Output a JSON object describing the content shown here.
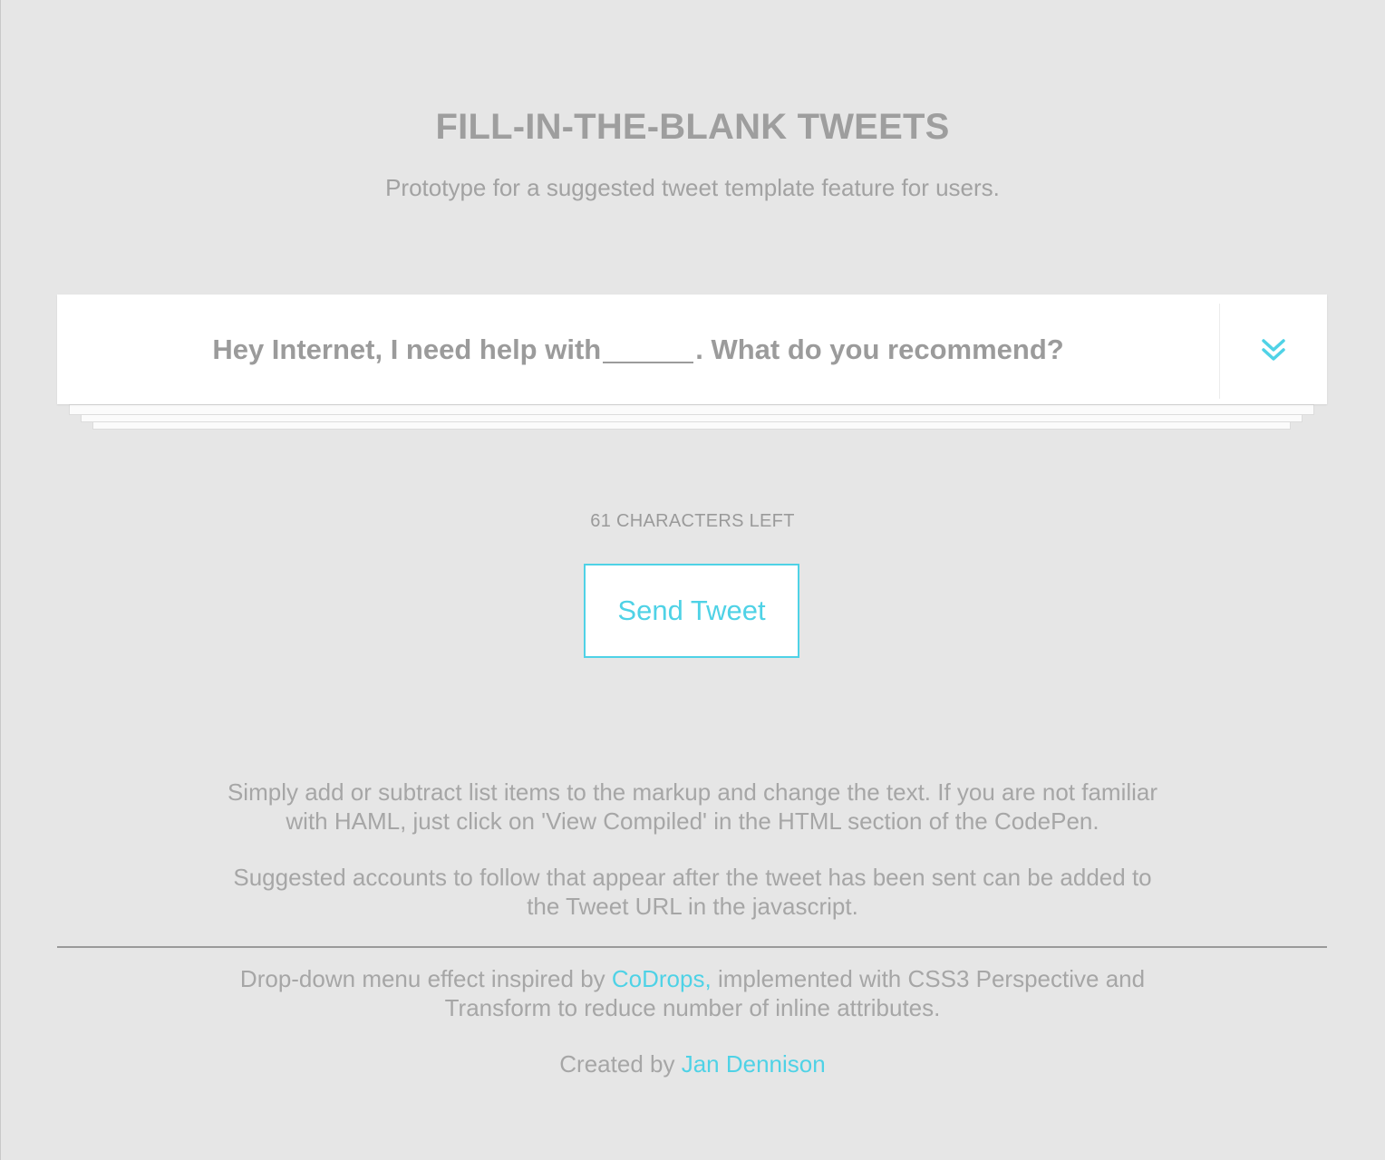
{
  "header": {
    "title": "FILL-IN-THE-BLANK TWEETS",
    "subtitle": "Prototype for a suggested tweet template feature for users."
  },
  "tweet_card": {
    "text_before_blank": "Hey Internet, I need help with",
    "text_after_blank": ". What do you recommend?",
    "dropdown_icon": "double-chevron-down-icon"
  },
  "counter": {
    "label": "61 CHARACTERS LEFT"
  },
  "actions": {
    "send_label": "Send Tweet"
  },
  "info": {
    "line1": "Simply add or subtract list items to the markup and change the text. If you are not familiar",
    "line2": "with HAML, just click on 'View Compiled' in the HTML section of the CodePen.",
    "line3": "Suggested accounts to follow that appear after the tweet has been sent can be added to",
    "line4": "the Tweet URL in the javascript."
  },
  "footer": {
    "credit_before": "Drop-down menu effect inspired by",
    "credit_link": "CoDrops,",
    "credit_after": "implemented with CSS3 Perspective and",
    "credit_line2": "Transform to reduce number of inline attributes.",
    "created_by": "Created by",
    "author_link": "Jan Dennison"
  },
  "colors": {
    "accent": "#4fd2e6",
    "text": "#9d9d9d",
    "background": "#e6e6e6"
  }
}
